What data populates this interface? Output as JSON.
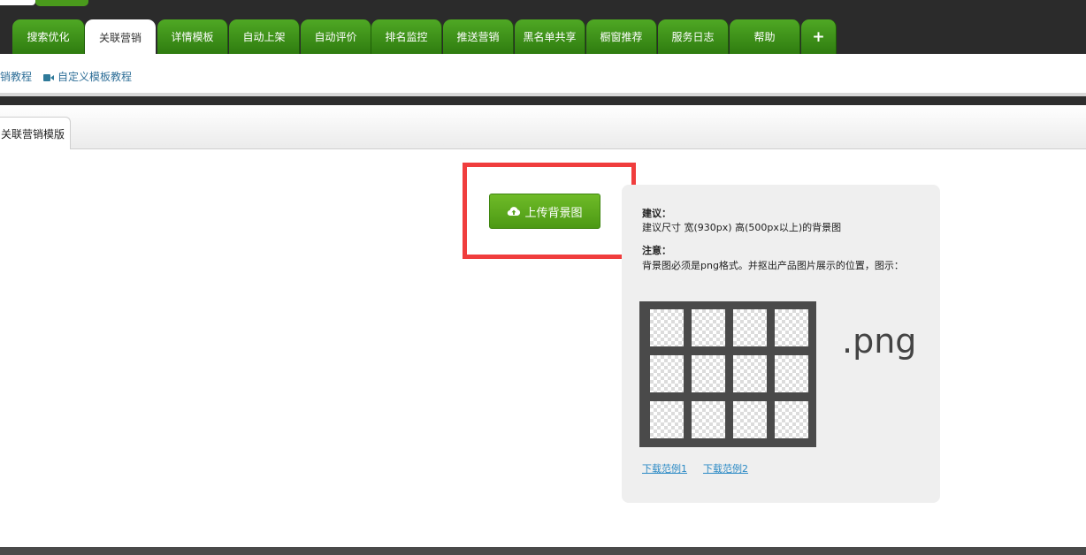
{
  "nav": {
    "tabs": [
      {
        "label": "搜索优化"
      },
      {
        "label": "关联营销",
        "active": true
      },
      {
        "label": "详情模板"
      },
      {
        "label": "自动上架"
      },
      {
        "label": "自动评价"
      },
      {
        "label": "排名监控"
      },
      {
        "label": "推送营销"
      },
      {
        "label": "黑名单共享"
      },
      {
        "label": "橱窗推荐"
      },
      {
        "label": "服务日志"
      },
      {
        "label": "帮助"
      },
      {
        "label": "+"
      }
    ]
  },
  "sublinks": {
    "tutorial_partial": "销教程",
    "custom_template_tutorial": "自定义模板教程",
    "icon": "video-camera-icon"
  },
  "inner_tabs": {
    "current": "关联营销模版"
  },
  "upload": {
    "button_label": "上传背景图",
    "icon": "cloud-upload-icon",
    "highlight_color": "#f03d3d"
  },
  "info": {
    "suggest_title": "建议：",
    "suggest_text": "建议尺寸 宽(930px) 高(500px以上)的背景图",
    "note_title": "注意：",
    "note_text": "背景图必须是png格式。并抠出产品图片展示的位置，图示：",
    "png_label": ".png",
    "download_1": "下载范例1",
    "download_2": "下载范例2"
  },
  "colors": {
    "tab_green": "#3f8f1a",
    "top_bar": "#2b2b2b",
    "link_blue": "#2b8ac5",
    "button_green": "#5eaa1f"
  }
}
